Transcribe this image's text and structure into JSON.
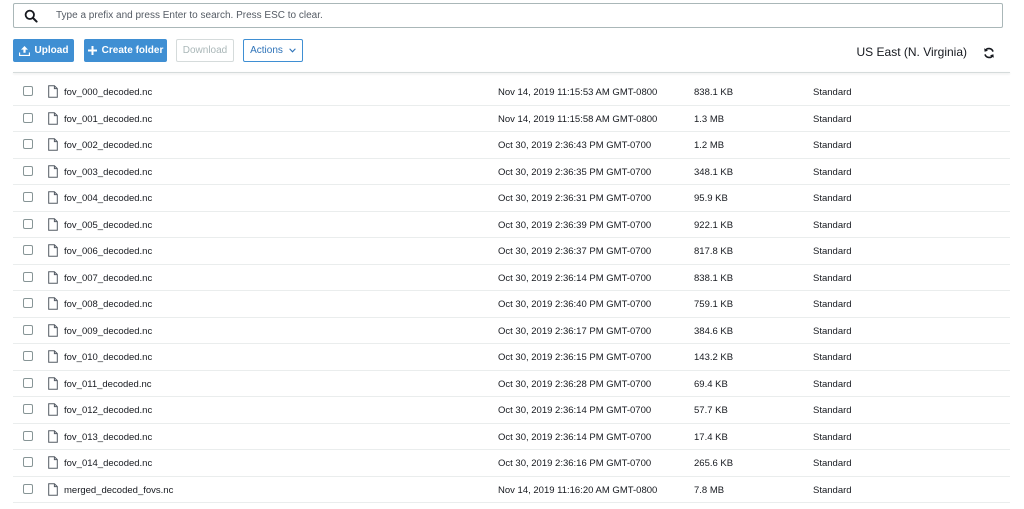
{
  "search": {
    "placeholder": "Type a prefix and press Enter to search. Press ESC to clear.",
    "value": ""
  },
  "toolbar": {
    "upload_label": "Upload",
    "create_folder_label": "Create folder",
    "download_label": "Download",
    "actions_label": "Actions",
    "region": "US East (N. Virginia)"
  },
  "colors": {
    "primary": "#3f8fd3",
    "link": "#2e73b8",
    "disabled_text": "#aab7b8",
    "border": "#d5dbdb"
  },
  "icons": [
    "search-icon",
    "upload-icon",
    "plus-icon",
    "chevron-down-icon",
    "refresh-icon",
    "file-icon",
    "checkbox"
  ],
  "files": [
    {
      "name": "fov_000_decoded.nc",
      "modified": "Nov 14, 2019 11:15:53 AM GMT-0800",
      "size": "838.1 KB",
      "storage_class": "Standard"
    },
    {
      "name": "fov_001_decoded.nc",
      "modified": "Nov 14, 2019 11:15:58 AM GMT-0800",
      "size": "1.3 MB",
      "storage_class": "Standard"
    },
    {
      "name": "fov_002_decoded.nc",
      "modified": "Oct 30, 2019 2:36:43 PM GMT-0700",
      "size": "1.2 MB",
      "storage_class": "Standard"
    },
    {
      "name": "fov_003_decoded.nc",
      "modified": "Oct 30, 2019 2:36:35 PM GMT-0700",
      "size": "348.1 KB",
      "storage_class": "Standard"
    },
    {
      "name": "fov_004_decoded.nc",
      "modified": "Oct 30, 2019 2:36:31 PM GMT-0700",
      "size": "95.9 KB",
      "storage_class": "Standard"
    },
    {
      "name": "fov_005_decoded.nc",
      "modified": "Oct 30, 2019 2:36:39 PM GMT-0700",
      "size": "922.1 KB",
      "storage_class": "Standard"
    },
    {
      "name": "fov_006_decoded.nc",
      "modified": "Oct 30, 2019 2:36:37 PM GMT-0700",
      "size": "817.8 KB",
      "storage_class": "Standard"
    },
    {
      "name": "fov_007_decoded.nc",
      "modified": "Oct 30, 2019 2:36:14 PM GMT-0700",
      "size": "838.1 KB",
      "storage_class": "Standard"
    },
    {
      "name": "fov_008_decoded.nc",
      "modified": "Oct 30, 2019 2:36:40 PM GMT-0700",
      "size": "759.1 KB",
      "storage_class": "Standard"
    },
    {
      "name": "fov_009_decoded.nc",
      "modified": "Oct 30, 2019 2:36:17 PM GMT-0700",
      "size": "384.6 KB",
      "storage_class": "Standard"
    },
    {
      "name": "fov_010_decoded.nc",
      "modified": "Oct 30, 2019 2:36:15 PM GMT-0700",
      "size": "143.2 KB",
      "storage_class": "Standard"
    },
    {
      "name": "fov_011_decoded.nc",
      "modified": "Oct 30, 2019 2:36:28 PM GMT-0700",
      "size": "69.4 KB",
      "storage_class": "Standard"
    },
    {
      "name": "fov_012_decoded.nc",
      "modified": "Oct 30, 2019 2:36:14 PM GMT-0700",
      "size": "57.7 KB",
      "storage_class": "Standard"
    },
    {
      "name": "fov_013_decoded.nc",
      "modified": "Oct 30, 2019 2:36:14 PM GMT-0700",
      "size": "17.4 KB",
      "storage_class": "Standard"
    },
    {
      "name": "fov_014_decoded.nc",
      "modified": "Oct 30, 2019 2:36:16 PM GMT-0700",
      "size": "265.6 KB",
      "storage_class": "Standard"
    },
    {
      "name": "merged_decoded_fovs.nc",
      "modified": "Nov 14, 2019 11:16:20 AM GMT-0800",
      "size": "7.8 MB",
      "storage_class": "Standard"
    }
  ]
}
